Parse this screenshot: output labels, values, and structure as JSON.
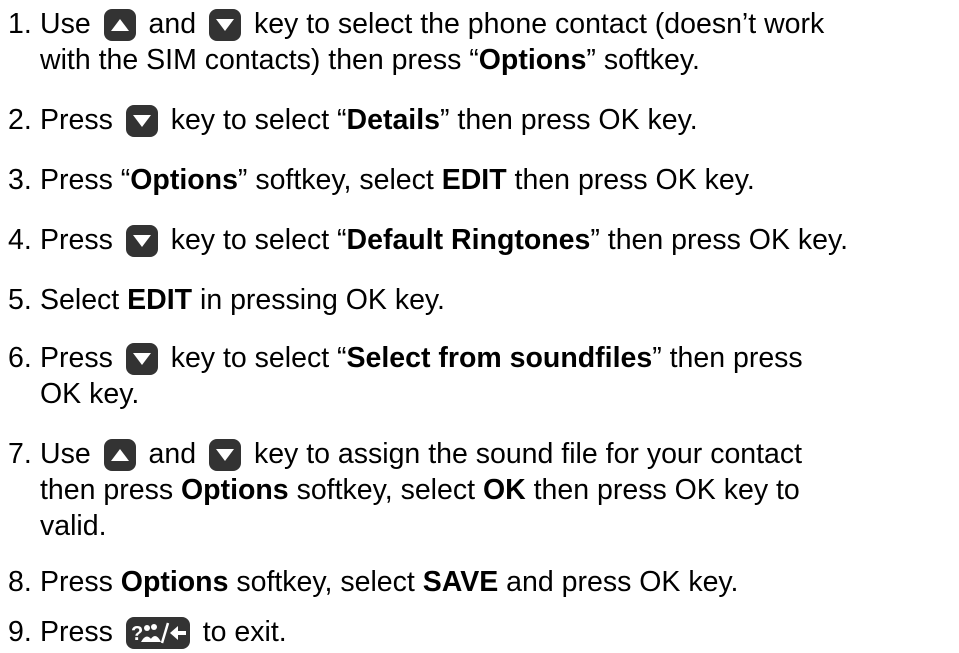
{
  "steps": [
    {
      "number": "1.",
      "lines": [
        [
          "Use",
          "UP",
          "and",
          "DOWN",
          "key to select the phone contact (doesn’t work"
        ],
        [
          "with the SIM contacts) then press “",
          "Options",
          "” softkey."
        ]
      ]
    },
    {
      "number": "2.",
      "lines": [
        [
          "Press",
          "DOWN",
          "key to select “",
          "Details",
          "” then press OK key."
        ]
      ]
    },
    {
      "number": "3.",
      "lines": [
        [
          "Press “",
          "Options",
          "” softkey, select ",
          "EDIT",
          " then press OK key."
        ]
      ]
    },
    {
      "number": "4.",
      "lines": [
        [
          "Press",
          "DOWN",
          "key to select “",
          "Default Ringtones",
          "” then press OK key."
        ]
      ]
    },
    {
      "number": "5.",
      "lines": [
        [
          "Select ",
          "EDIT",
          " in pressing OK key."
        ]
      ]
    },
    {
      "number": "6.",
      "lines": [
        [
          "Press",
          "DOWN",
          "key to select “",
          "Select from soundfiles",
          "” then press"
        ],
        [
          "OK key."
        ]
      ]
    },
    {
      "number": "7.",
      "lines": [
        [
          "Use",
          "UP",
          "and",
          "DOWN",
          "key to assign the sound file for your contact"
        ],
        [
          "then press ",
          "Options",
          " softkey, select ",
          "OK",
          " then press OK key to"
        ],
        [
          "valid."
        ]
      ]
    },
    {
      "number": "8.",
      "lines": [
        [
          "Press ",
          "Options",
          " softkey, select ",
          "SAVE",
          " and press OK key."
        ]
      ]
    },
    {
      "number": "9.",
      "lines": [
        [
          "Press",
          "EXIT",
          "to exit."
        ]
      ]
    }
  ],
  "icons": {
    "up": "up-arrow-key-icon",
    "down": "down-arrow-key-icon",
    "exit": "help-back-key-icon"
  },
  "colors": {
    "key_fill": "#333333",
    "key_glyph": "#ffffff",
    "text": "#000000"
  }
}
